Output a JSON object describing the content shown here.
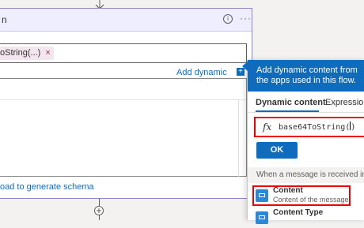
{
  "card": {
    "title": "n",
    "info_glyph": "i",
    "more_glyph": "···",
    "token_label": "oString(...)",
    "token_remove": "×",
    "add_dynamic_label": "Add dynamic content",
    "add_dynamic_plus": "+",
    "schema_link": "oad to generate schema"
  },
  "panel": {
    "header_text": "Add dynamic content from the apps used in this flow.",
    "tabs": [
      {
        "label": "Dynamic content",
        "active": true
      },
      {
        "label": "Expression",
        "active": false
      }
    ],
    "fx_symbol": "fx",
    "expression_value": "base64ToString(",
    "expression_tail": ")",
    "ok_label": "OK",
    "section_label": "When a message is received in a queue",
    "items": [
      {
        "title": "Content",
        "subtitle": "Content of the message",
        "icon": "message-content-icon"
      },
      {
        "title": "Content Type",
        "subtitle": "",
        "icon": "message-content-icon"
      }
    ]
  },
  "colors": {
    "accent": "#0f6cbd",
    "highlight": "#ee0000",
    "token_bg": "#f3e6ef"
  },
  "icons": [
    "arrow-down-icon",
    "info-icon",
    "more-icon",
    "plus-icon",
    "fx-icon",
    "add-step-icon"
  ]
}
